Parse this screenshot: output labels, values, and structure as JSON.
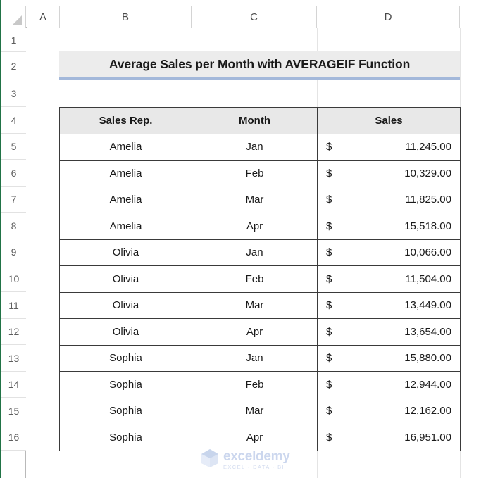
{
  "app": {
    "type": "spreadsheet",
    "accent_green": "#217346",
    "title_band_bg": "#ececec",
    "title_band_border": "#a3b8da",
    "table_header_bg": "#e8e8e8",
    "table_border": "#3a3a3a"
  },
  "grid": {
    "column_headers": [
      "A",
      "B",
      "C",
      "D"
    ],
    "row_headers": [
      "1",
      "2",
      "3",
      "4",
      "5",
      "6",
      "7",
      "8",
      "9",
      "10",
      "11",
      "12",
      "13",
      "14",
      "15",
      "16"
    ]
  },
  "title": {
    "text": "Average Sales per Month with AVERAGEIF Function"
  },
  "table": {
    "headers": [
      "Sales Rep.",
      "Month",
      "Sales"
    ],
    "rows": [
      {
        "rep": "Amelia",
        "month": "Jan",
        "currency": "$",
        "amount": "11,245.00"
      },
      {
        "rep": "Amelia",
        "month": "Feb",
        "currency": "$",
        "amount": "10,329.00"
      },
      {
        "rep": "Amelia",
        "month": "Mar",
        "currency": "$",
        "amount": "11,825.00"
      },
      {
        "rep": "Amelia",
        "month": "Apr",
        "currency": "$",
        "amount": "15,518.00"
      },
      {
        "rep": "Olivia",
        "month": "Jan",
        "currency": "$",
        "amount": "10,066.00"
      },
      {
        "rep": "Olivia",
        "month": "Feb",
        "currency": "$",
        "amount": "11,504.00"
      },
      {
        "rep": "Olivia",
        "month": "Mar",
        "currency": "$",
        "amount": "13,449.00"
      },
      {
        "rep": "Olivia",
        "month": "Apr",
        "currency": "$",
        "amount": "13,654.00"
      },
      {
        "rep": "Sophia",
        "month": "Jan",
        "currency": "$",
        "amount": "15,880.00"
      },
      {
        "rep": "Sophia",
        "month": "Feb",
        "currency": "$",
        "amount": "12,944.00"
      },
      {
        "rep": "Sophia",
        "month": "Mar",
        "currency": "$",
        "amount": "12,162.00"
      },
      {
        "rep": "Sophia",
        "month": "Apr",
        "currency": "$",
        "amount": "16,951.00"
      }
    ]
  },
  "watermark": {
    "name": "exceldemy",
    "tagline": "EXCEL · DATA · BI",
    "color": "#ccd7ee"
  }
}
